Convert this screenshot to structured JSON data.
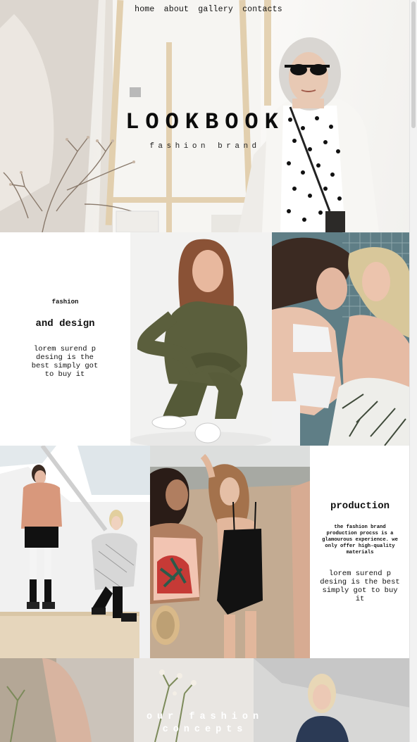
{
  "nav": {
    "items": [
      "home",
      "about",
      "gallery",
      "contacts"
    ]
  },
  "hero": {
    "title": "LOOKBOOK",
    "subtitle": "fashion brand"
  },
  "section1": {
    "eyebrow": "fashion",
    "heading": "and design",
    "body": "lorem surend p desing is the best simply got to buy it"
  },
  "section2": {
    "heading": "production",
    "intro": "the fashion brand production procss is a glamourous experience. we only offer high-quality materials",
    "body": "lorem surend p desing is the best simply got to buy it"
  },
  "banner": {
    "line1": "our fashion",
    "line2": "concepts"
  },
  "colors": {
    "text": "#111111",
    "background": "#ffffff"
  }
}
